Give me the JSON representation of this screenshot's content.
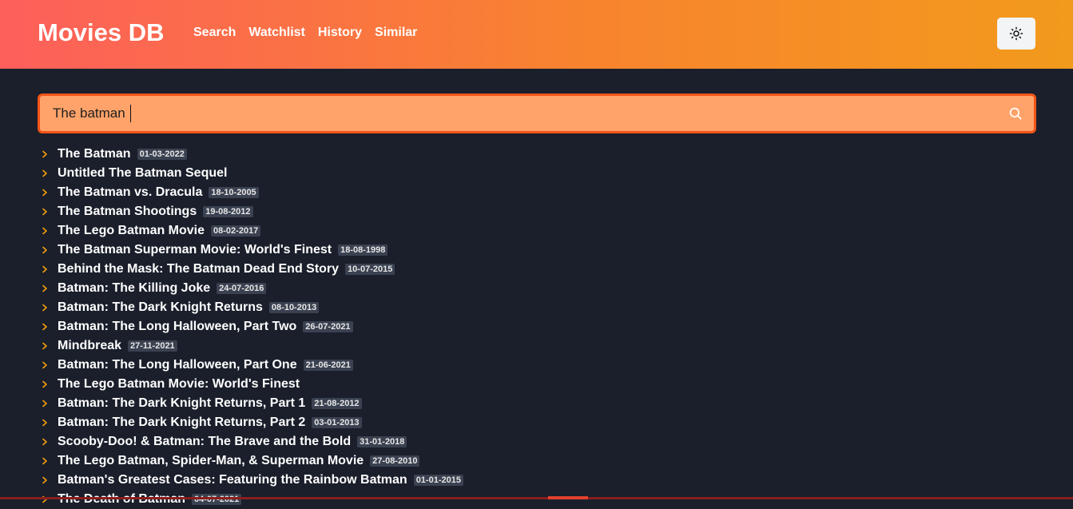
{
  "header": {
    "brand": "Movies DB",
    "nav": [
      "Search",
      "Watchlist",
      "History",
      "Similar"
    ],
    "theme_icon": "sun-icon",
    "gradient": [
      "#fd5f5b",
      "#f8842e",
      "#f29a1c"
    ]
  },
  "search": {
    "value": "The batman",
    "icon": "search-icon",
    "background": "#ffa36a",
    "border": "#f2541a"
  },
  "results": [
    {
      "title": "The Batman",
      "date": "01-03-2022"
    },
    {
      "title": "Untitled The Batman Sequel",
      "date": ""
    },
    {
      "title": "The Batman vs. Dracula",
      "date": "18-10-2005"
    },
    {
      "title": "The Batman Shootings",
      "date": "19-08-2012"
    },
    {
      "title": "The Lego Batman Movie",
      "date": "08-02-2017"
    },
    {
      "title": "The Batman Superman Movie: World's Finest",
      "date": "18-08-1998"
    },
    {
      "title": "Behind the Mask: The Batman Dead End Story",
      "date": "10-07-2015"
    },
    {
      "title": "Batman: The Killing Joke",
      "date": "24-07-2016"
    },
    {
      "title": "Batman: The Dark Knight Returns",
      "date": "08-10-2013"
    },
    {
      "title": "Batman: The Long Halloween, Part Two",
      "date": "26-07-2021"
    },
    {
      "title": "Mindbreak",
      "date": "27-11-2021"
    },
    {
      "title": "Batman: The Long Halloween, Part One",
      "date": "21-06-2021"
    },
    {
      "title": "The Lego Batman Movie: World's Finest",
      "date": ""
    },
    {
      "title": "Batman: The Dark Knight Returns, Part 1",
      "date": "21-08-2012"
    },
    {
      "title": "Batman: The Dark Knight Returns, Part 2",
      "date": "03-01-2013"
    },
    {
      "title": "Scooby-Doo! & Batman: The Brave and the Bold",
      "date": "31-01-2018"
    },
    {
      "title": "The Lego Batman, Spider-Man, & Superman Movie",
      "date": "27-08-2010"
    },
    {
      "title": "Batman's Greatest Cases: Featuring the Rainbow Batman",
      "date": "01-01-2015"
    },
    {
      "title": "The Death of Batman",
      "date": "04-07-2021"
    }
  ],
  "colors": {
    "page_bg": "#1a1f2b",
    "chevron": "#f59e0b",
    "date_badge_bg": "#3a4150"
  }
}
